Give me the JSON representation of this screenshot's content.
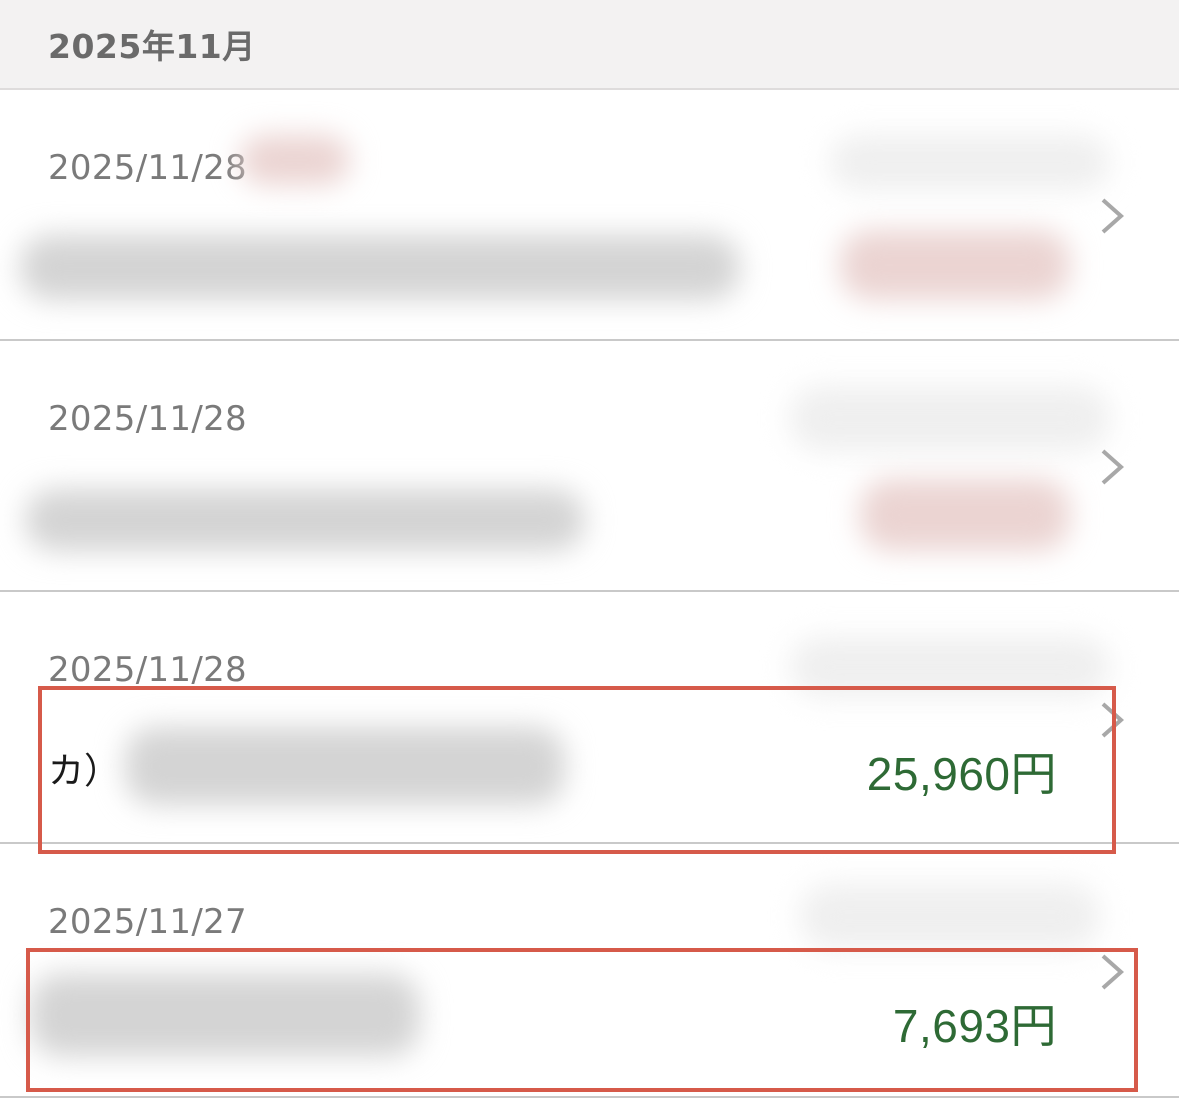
{
  "month_header": {
    "label": "2025年11月"
  },
  "transactions": [
    {
      "date": "2025/11/28",
      "description": "",
      "amount": ""
    },
    {
      "date": "2025/11/28",
      "description": "",
      "amount": ""
    },
    {
      "date": "2025/11/28",
      "description": "カ）",
      "amount": "25,960円"
    },
    {
      "date": "2025/11/27",
      "description": "",
      "amount": "7,693円"
    }
  ],
  "icons": {
    "row_chevron": "chevron-right-icon"
  },
  "colors": {
    "amount_income": "#2e6a35",
    "highlight_border": "#d65a4a",
    "header_background": "#f3f2f2",
    "date_text": "#7a7a7a"
  }
}
